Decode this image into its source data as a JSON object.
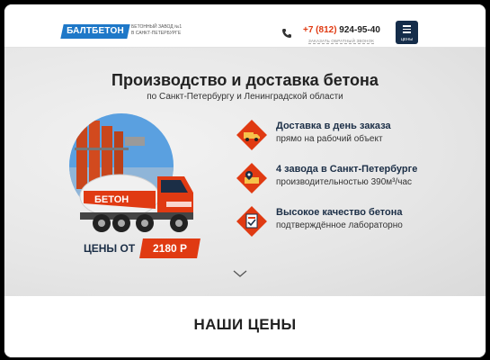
{
  "header": {
    "logo_text": "БАЛТБЕТОН",
    "tagline_line1": "БЕТОННЫЙ ЗАВОД №1",
    "tagline_line2": "В САНКТ-ПЕТЕРБУРГЕ",
    "phone_code": "+7 (812)",
    "phone_number": " 924-95-40",
    "callback_label": "ЗАКАЗАТЬ ОБРАТНЫЙ ЗВОНОК",
    "menu_label": "ЦЕНЫ"
  },
  "hero": {
    "title": "Производство и доставка бетона",
    "subtitle": "по Санкт-Петербургу и Ленинградской области",
    "truck_text": "БЕТОН",
    "price_label": "ЦЕНЫ ОТ",
    "price_value": "2180 Р",
    "features": [
      {
        "title": "Доставка в день заказа",
        "desc": "прямо на рабочий объект",
        "icon": "truck-icon"
      },
      {
        "title": "4 завода в Санкт-Петербурге",
        "desc": "производительностью 390м³/час",
        "icon": "map-pin-icon"
      },
      {
        "title": "Высокое качество бетона",
        "desc": "подтверждённое лабораторно",
        "icon": "quality-icon"
      }
    ]
  },
  "prices_section": {
    "title": "НАШИ ЦЕНЫ"
  },
  "colors": {
    "accent": "#e03a12",
    "brand_blue": "#1e78c8",
    "dark_navy": "#152d4a"
  }
}
